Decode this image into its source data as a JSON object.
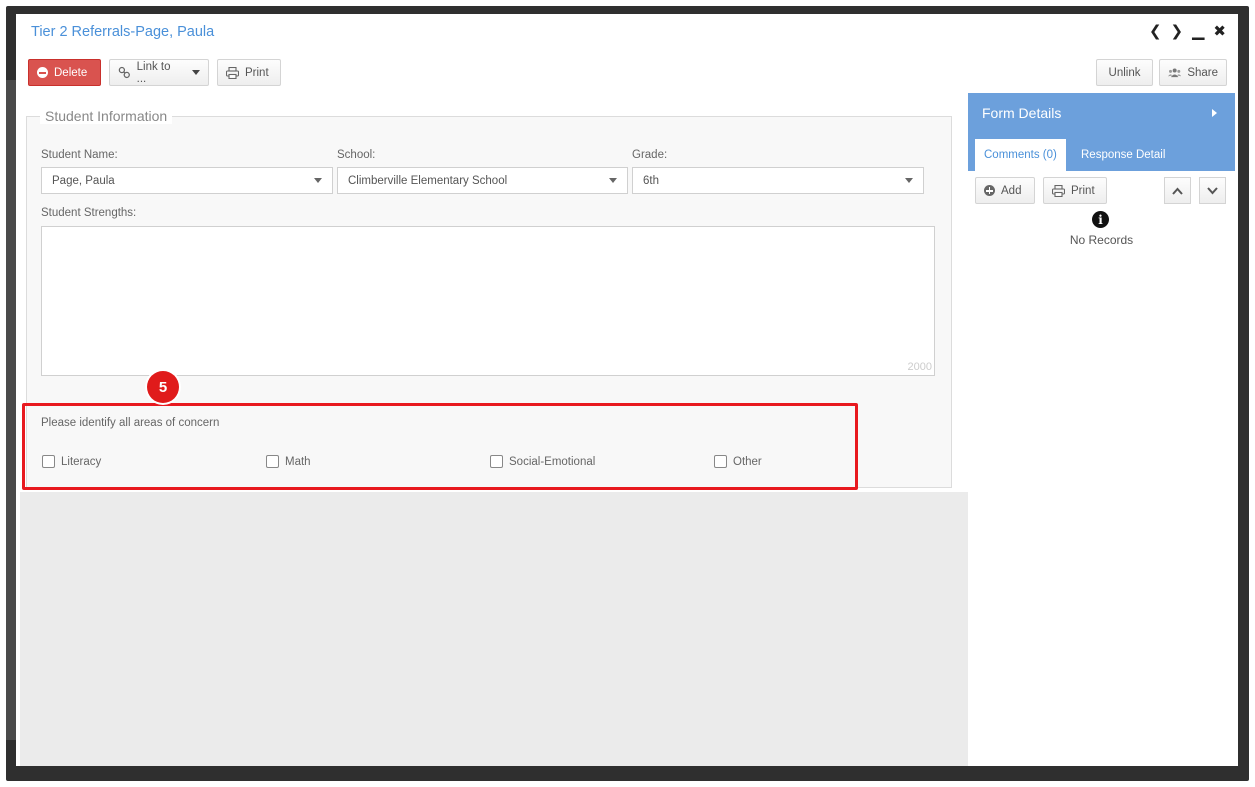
{
  "window": {
    "title": "Tier 2 Referrals-Page, Paula",
    "prev_icon": "chevron-left-icon",
    "next_icon": "chevron-right-icon",
    "minimize_icon": "minimize-icon",
    "close_icon": "close-icon"
  },
  "toolbar": {
    "delete_label": "Delete",
    "link_label": "Link to ...",
    "print_label": "Print",
    "unlink_label": "Unlink",
    "share_label": "Share"
  },
  "form": {
    "section_title": "Student Information",
    "student_name_label": "Student Name:",
    "student_name_value": "Page, Paula",
    "school_label": "School:",
    "school_value": "Climberville Elementary School",
    "grade_label": "Grade:",
    "grade_value": "6th",
    "strengths_label": "Student Strengths:",
    "strengths_counter": "2000",
    "concern_question": "Please identify all areas of concern",
    "concerns": [
      "Literacy",
      "Math",
      "Social-Emotional",
      "Other"
    ]
  },
  "annotation": {
    "step_badge": "5",
    "highlight_color": "#e8191f"
  },
  "side_panel": {
    "title": "Form Details",
    "tabs": [
      "Comments (0)",
      "Response Detail"
    ],
    "add_label": "Add",
    "print_label": "Print",
    "no_records": "No Records"
  },
  "colors": {
    "accent": "#6ca0dc",
    "delete": "#d9534f",
    "title": "#4a90d9"
  }
}
